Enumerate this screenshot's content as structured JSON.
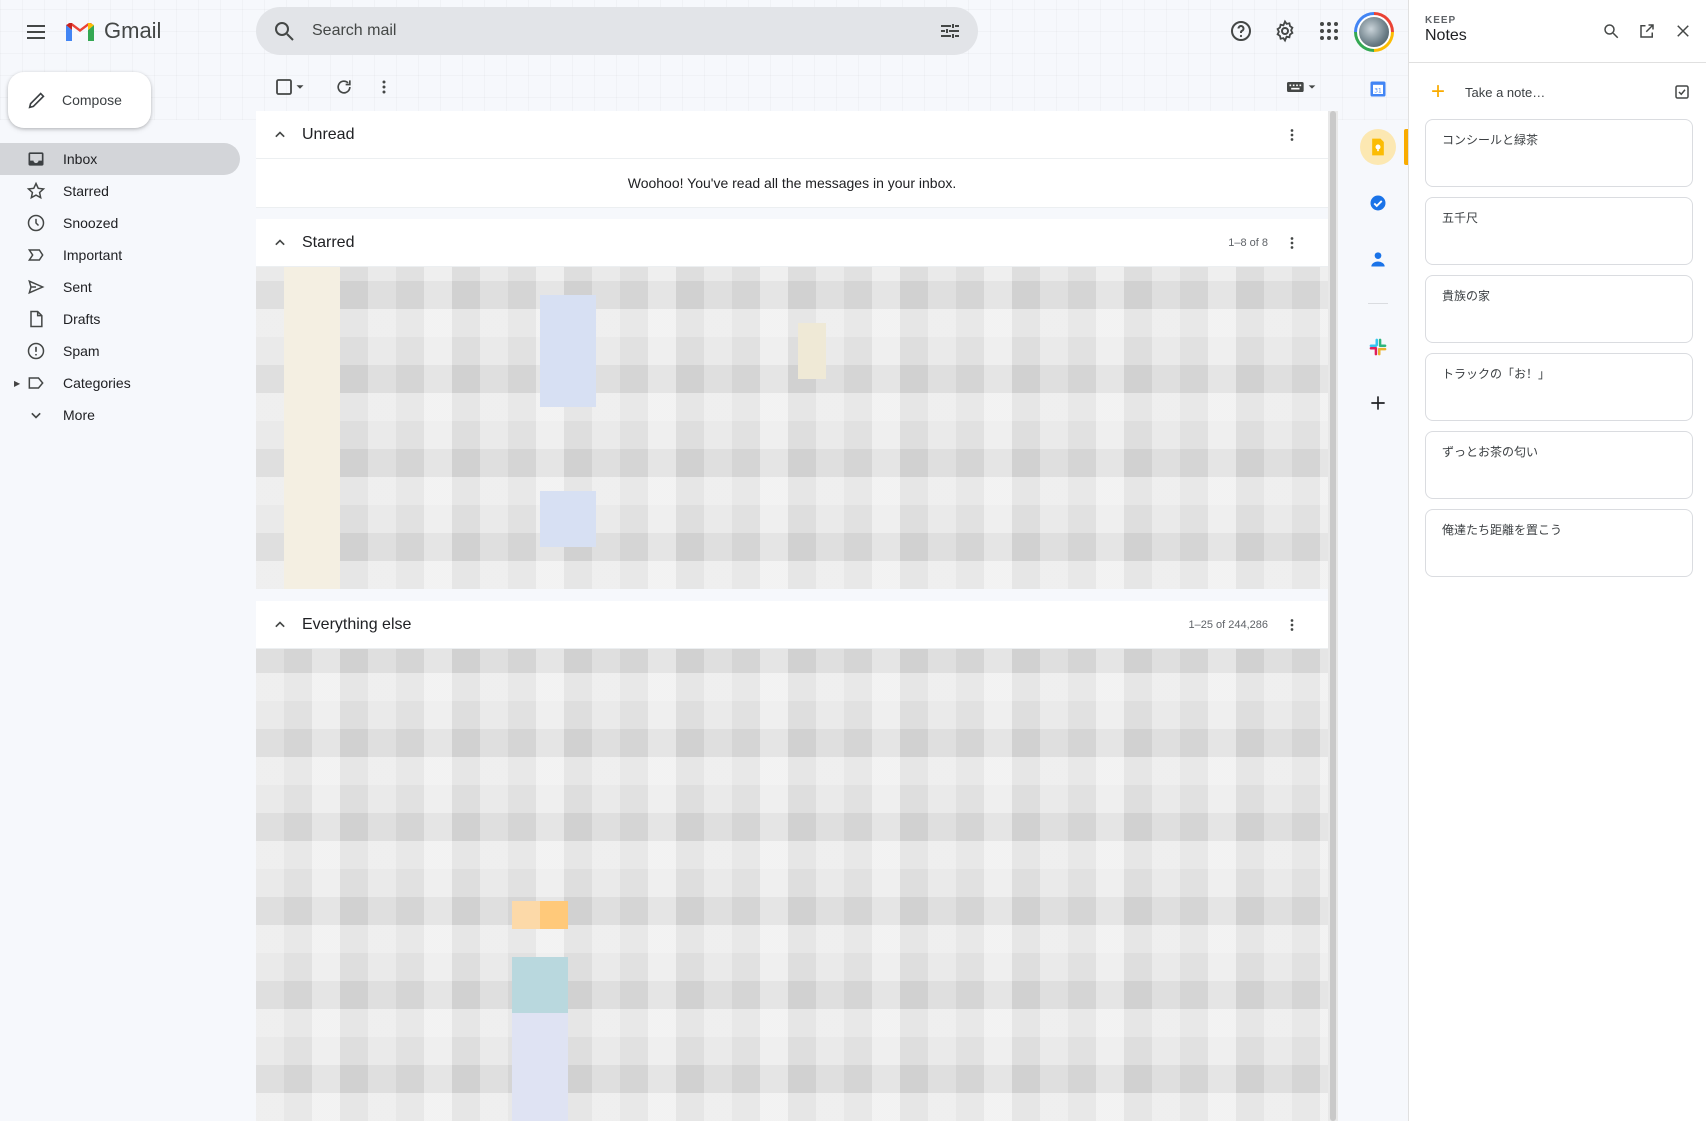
{
  "app": {
    "name": "Gmail"
  },
  "search": {
    "placeholder": "Search mail"
  },
  "compose": {
    "label": "Compose"
  },
  "nav": {
    "items": [
      {
        "label": "Inbox",
        "icon": "inbox-icon",
        "active": true
      },
      {
        "label": "Starred",
        "icon": "star-icon"
      },
      {
        "label": "Snoozed",
        "icon": "clock-icon"
      },
      {
        "label": "Important",
        "icon": "important-icon"
      },
      {
        "label": "Sent",
        "icon": "send-icon"
      },
      {
        "label": "Drafts",
        "icon": "draft-icon"
      },
      {
        "label": "Spam",
        "icon": "spam-icon"
      },
      {
        "label": "Categories",
        "icon": "label-icon"
      },
      {
        "label": "More",
        "icon": "chevron-down-icon"
      }
    ]
  },
  "sections": {
    "unread": {
      "title": "Unread",
      "empty_message": "Woohoo! You've read all the messages in your inbox."
    },
    "starred": {
      "title": "Starred",
      "count": "1–8 of 8"
    },
    "everything_else": {
      "title": "Everything else",
      "count": "1–25 of 244,286"
    }
  },
  "keep": {
    "small_label": "KEEP",
    "title": "Notes",
    "take_note": "Take a note…",
    "notes": [
      "コンシールと緑茶",
      "五千尺",
      "貴族の家",
      "トラックの「お！」",
      "ずっとお茶の匂い",
      "俺達たち距離を置こう"
    ]
  },
  "colors": {
    "accent_keep": "#f9ab00",
    "gmail_red": "#ea4335",
    "gmail_blue": "#4285f4",
    "gmail_green": "#34a853",
    "gmail_yellow": "#fbbc04"
  }
}
